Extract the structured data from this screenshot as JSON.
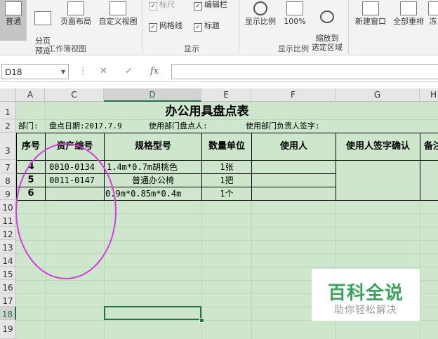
{
  "ribbon": {
    "workbook_views": {
      "group_label": "工作簿视图",
      "buttons": [
        "普通",
        "分页\n预览",
        "页面布局",
        "自定义视图"
      ]
    },
    "show": {
      "group_label": "显示",
      "ruler": "标尺",
      "edit_bar": "编辑栏",
      "gridlines": "网格线",
      "headings": "标题"
    },
    "zoom": {
      "group_label": "显示比例",
      "zoom": "显示比例",
      "zoom100": "100%",
      "zoom_selection": "缩放到\n选定区域"
    },
    "window": {
      "new_window": "新建窗口",
      "arrange_all": "全部重排",
      "freeze": "冻"
    }
  },
  "formula_bar": {
    "name_box": "D18",
    "fx": "fx",
    "content": ""
  },
  "columns": [
    "A",
    "C",
    "D",
    "E",
    "F",
    "G",
    "H"
  ],
  "rows": [
    "1",
    "2",
    "3",
    "7",
    "8",
    "9",
    "10",
    "11",
    "12",
    "13",
    "14",
    "15",
    "16",
    "17",
    "18",
    "19"
  ],
  "sheet": {
    "title": "办公用具盘点表",
    "row2": {
      "dept": "部门:",
      "date": "盘点日期:2017.7.9",
      "dept_counter": "使用部门盘点人:",
      "dept_head": "使用部门负责人签字:"
    },
    "headers": [
      "序号",
      "资产编号",
      "规格型号",
      "数量单位",
      "使用人",
      "使用人签字确认",
      "备注"
    ],
    "data_rows": [
      {
        "no": "4",
        "asset": "0010-0134",
        "spec": "1.4m*0.7m胡桃色",
        "qty": "1张"
      },
      {
        "no": "5",
        "asset": "0011-0147",
        "spec": "普通办公椅",
        "qty": "1把"
      },
      {
        "no": "6",
        "asset": "",
        "spec": "0.9m*0.85m*0.4m",
        "qty": "1个"
      }
    ]
  },
  "watermark": {
    "title": "百科全说",
    "subtitle": "助你轻松解决"
  },
  "colors": {
    "grid_bg": "#cde6cc",
    "selection": "#217346",
    "annotation": "#d63be0",
    "watermark": "#3aa55a"
  }
}
